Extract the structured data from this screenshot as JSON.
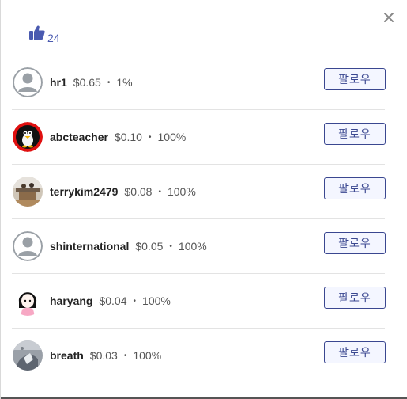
{
  "header": {
    "like_icon": "thumbs-up-icon",
    "like_count": "24",
    "close_icon": "close-icon"
  },
  "voters": [
    {
      "name": "hr1",
      "amount": "$0.65",
      "percent": "1%",
      "follow_label": "팔로우",
      "avatar": "default-avatar"
    },
    {
      "name": "abcteacher",
      "amount": "$0.10",
      "percent": "100%",
      "follow_label": "팔로우",
      "avatar": "penguin-avatar"
    },
    {
      "name": "terrykim2479",
      "amount": "$0.08",
      "percent": "100%",
      "follow_label": "팔로우",
      "avatar": "photo-avatar"
    },
    {
      "name": "shinternational",
      "amount": "$0.05",
      "percent": "100%",
      "follow_label": "팔로우",
      "avatar": "default-avatar"
    },
    {
      "name": "haryang",
      "amount": "$0.04",
      "percent": "100%",
      "follow_label": "팔로우",
      "avatar": "girl-avatar"
    },
    {
      "name": "breath",
      "amount": "$0.03",
      "percent": "100%",
      "follow_label": "팔로우",
      "avatar": "photo-avatar"
    }
  ],
  "colors": {
    "accent": "#4a5ab0",
    "button_border": "#3a4790",
    "button_bg": "#f4f6ff"
  }
}
